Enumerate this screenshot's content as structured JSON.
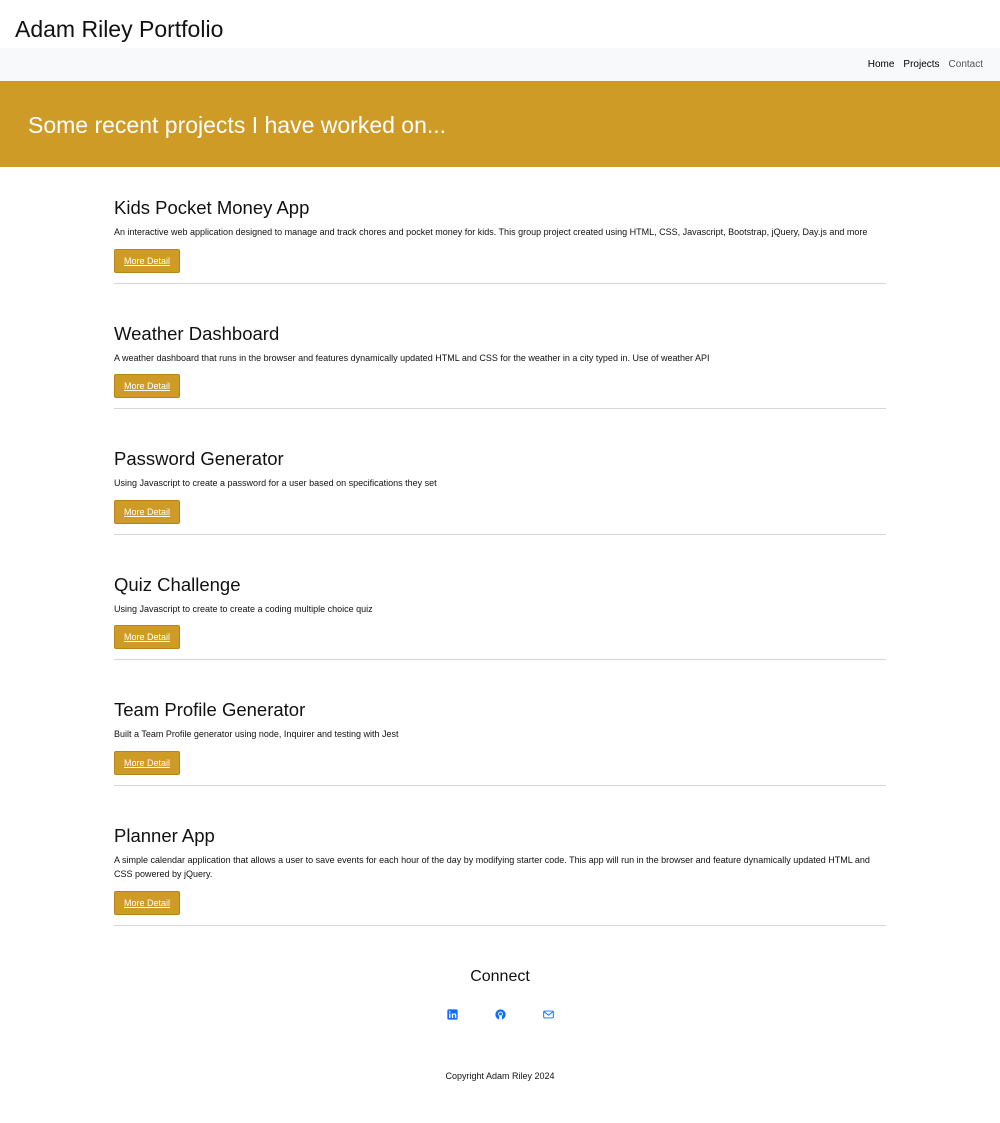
{
  "header": {
    "title": "Adam Riley Portfolio"
  },
  "nav": {
    "home": "Home",
    "projects": "Projects",
    "contact": "Contact"
  },
  "hero": {
    "title": "Some recent projects I have worked on..."
  },
  "projects": [
    {
      "title": "Kids Pocket Money App",
      "description": "An interactive web application designed to manage and track chores and pocket money for kids. This group project created using HTML, CSS, Javascript, Bootstrap, jQuery, Day.js and more",
      "button": "More Detail"
    },
    {
      "title": "Weather Dashboard",
      "description": "A weather dashboard that runs in the browser and features dynamically updated HTML and CSS for the weather in a city typed in. Use of weather API",
      "button": "More Detail"
    },
    {
      "title": "Password Generator",
      "description": "Using Javascript to create a password for a user based on specifications they set",
      "button": "More Detail"
    },
    {
      "title": "Quiz Challenge",
      "description": "Using Javascript to create to create a coding multiple choice quiz",
      "button": "More Detail"
    },
    {
      "title": "Team Profile Generator",
      "description": "Built a Team Profile generator using node, Inquirer and testing with Jest",
      "button": "More Detail"
    },
    {
      "title": "Planner App",
      "description": "A simple calendar application that allows a user to save events for each hour of the day by modifying starter code. This app will run in the browser and feature dynamically updated HTML and CSS powered by jQuery.",
      "button": "More Detail"
    }
  ],
  "connect": {
    "title": "Connect",
    "icons": [
      "linkedin-icon",
      "github-icon",
      "email-icon"
    ],
    "icon_color": "#0d6efd"
  },
  "footer": {
    "copyright": "Copyright Adam Riley 2024"
  },
  "colors": {
    "accent": "#cf9b27",
    "nav_background": "#f8f9fa"
  }
}
